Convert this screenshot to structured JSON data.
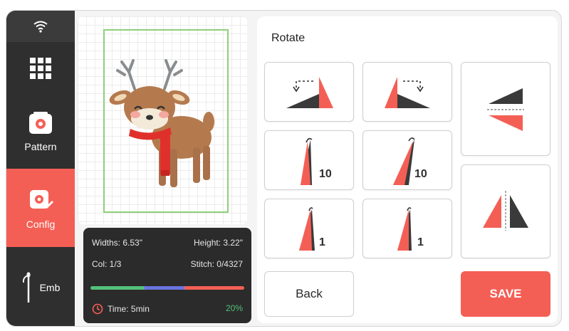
{
  "sidebar": {
    "items": [
      {
        "label": ""
      },
      {
        "label": "Pattern"
      },
      {
        "label": "Config"
      },
      {
        "label": "Emb"
      }
    ]
  },
  "info": {
    "widths": "Widths: 6.53\"",
    "height": "Height: 3.22\"",
    "col": "Col: 1/3",
    "stitch": "Stitch: 0/4327",
    "time": "Time: 5min",
    "progress": "20%",
    "progress_value": 0.2
  },
  "main": {
    "title": "Rotate",
    "numbers": {
      "rot10_a": "10",
      "rot10_b": "10",
      "rot1_a": "1",
      "rot1_b": "1"
    },
    "back_label": "Back",
    "save_label": "SAVE"
  },
  "colors": {
    "accent": "#f45f55",
    "dark": "#2f2f2f",
    "green": "#53c07a",
    "blue": "#6b73e0"
  }
}
